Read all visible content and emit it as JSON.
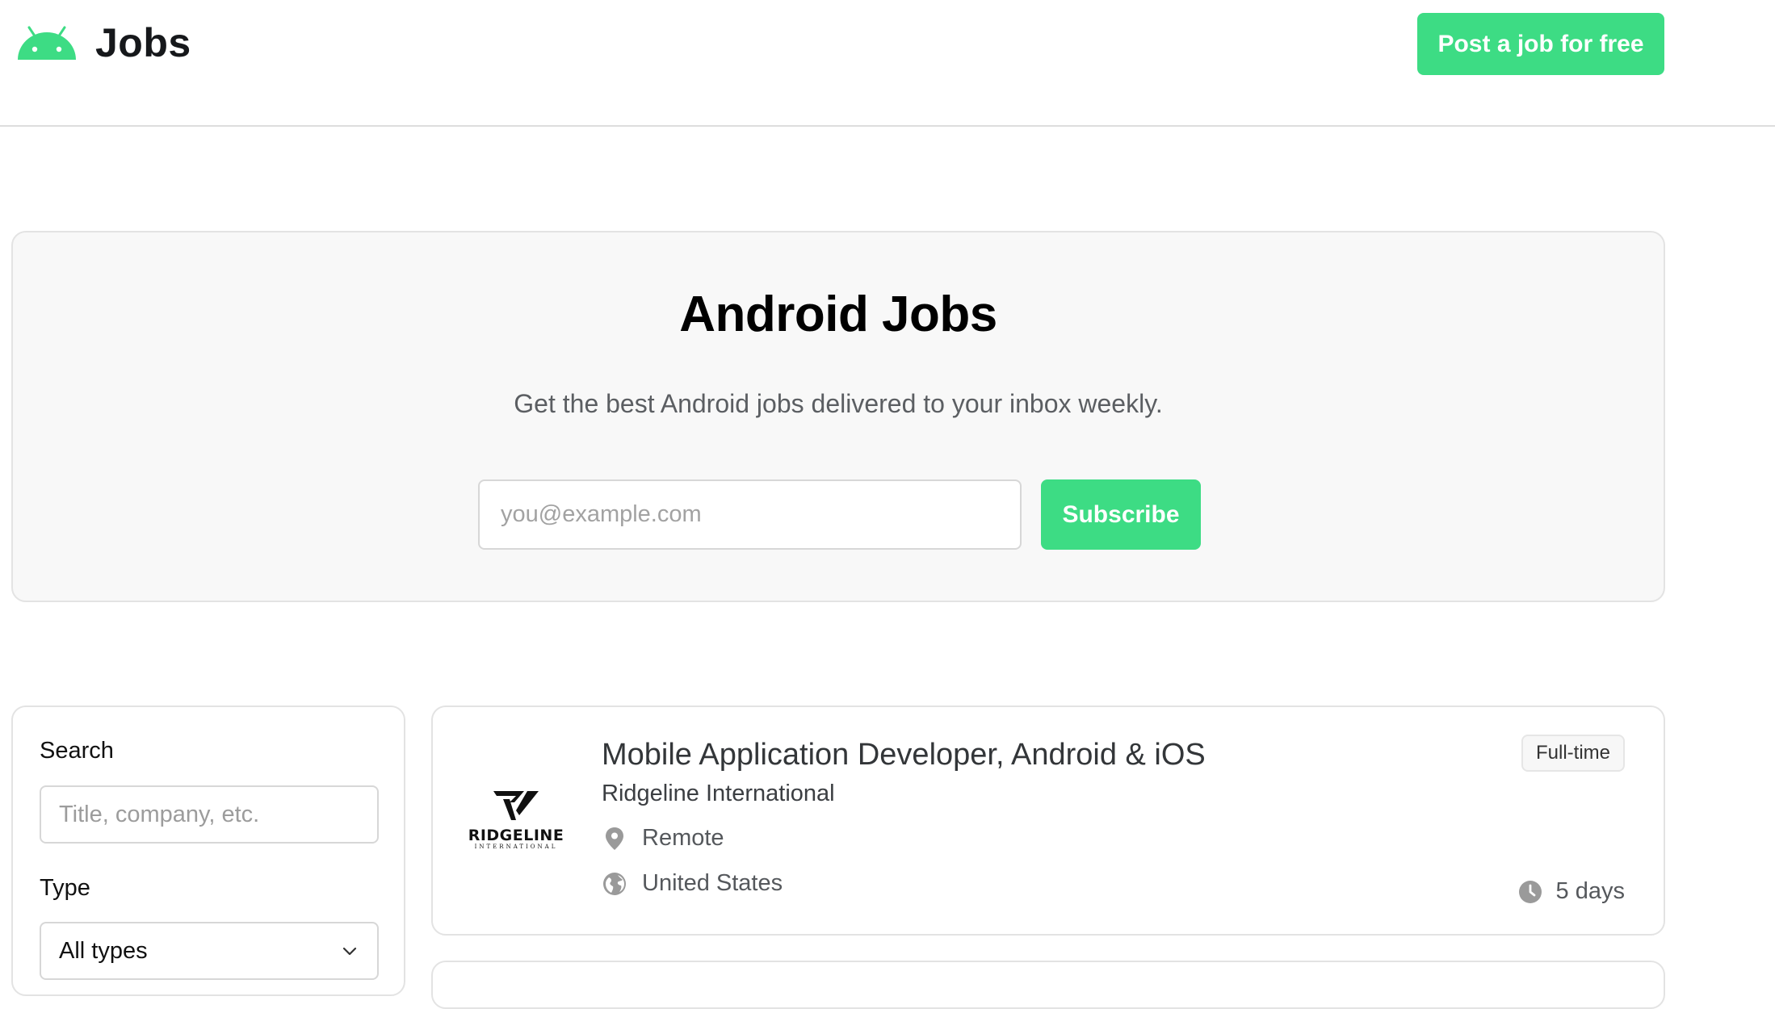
{
  "header": {
    "brand": "Jobs",
    "logo_icon": "android-icon",
    "post_job_label": "Post a job for free",
    "accent_color": "#3ddc84"
  },
  "hero": {
    "title": "Android Jobs",
    "subtitle": "Get the best Android jobs delivered to your inbox weekly.",
    "email_placeholder": "you@example.com",
    "subscribe_label": "Subscribe"
  },
  "filters": {
    "search_label": "Search",
    "search_placeholder": "Title, company, etc.",
    "type_label": "Type",
    "type_selected": "All types"
  },
  "jobs": [
    {
      "title": "Mobile Application Developer, Android & iOS",
      "company": "Ridgeline International",
      "logo_word": "RIDGELINE",
      "logo_sub": "INTERNATIONAL",
      "location": "Remote",
      "country": "United States",
      "type": "Full-time",
      "age": "5 days"
    }
  ]
}
